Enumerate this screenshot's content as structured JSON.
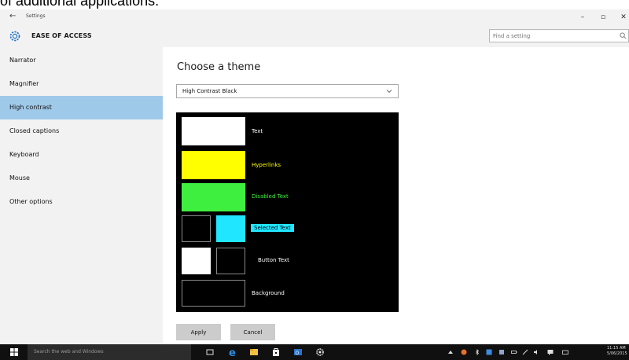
{
  "doc_caption": "of additional applications.",
  "window": {
    "title": "Settings",
    "back_glyph": "←",
    "minimize_glyph": "–",
    "restore_glyph": "▫",
    "close_glyph": "✕"
  },
  "header": {
    "section_title": "EASE OF ACCESS",
    "search_placeholder": "Find a setting"
  },
  "sidebar": {
    "items": [
      {
        "label": "Narrator",
        "active": false
      },
      {
        "label": "Magnifier",
        "active": false
      },
      {
        "label": "High contrast",
        "active": true
      },
      {
        "label": "Closed captions",
        "active": false
      },
      {
        "label": "Keyboard",
        "active": false
      },
      {
        "label": "Mouse",
        "active": false
      },
      {
        "label": "Other options",
        "active": false
      }
    ]
  },
  "main": {
    "title": "Choose a theme",
    "theme_select": {
      "value": "High Contrast Black"
    },
    "preview": {
      "text_label": "Text",
      "hyperlinks_label": "Hyperlinks",
      "disabled_label": "Disabled Text",
      "selected_label": "Selected Text",
      "button_label": "Button Text",
      "background_label": "Background"
    },
    "apply_label": "Apply",
    "cancel_label": "Cancel"
  },
  "colors": {
    "accent": "#9fc9e9",
    "text_color": "#ffffff",
    "hyperlink_color": "#ffff00",
    "disabled_color": "#3fef3f",
    "selected_color": "#20e6ff",
    "background_color": "#000000"
  },
  "taskbar": {
    "search_placeholder": "Search the web and Windows",
    "clock_time": "11:15 AM",
    "clock_date": "5/06/2015",
    "apps": [
      "task-view-icon",
      "edge-icon",
      "file-explorer-icon",
      "store-icon",
      "outlook-icon",
      "settings-icon"
    ]
  }
}
